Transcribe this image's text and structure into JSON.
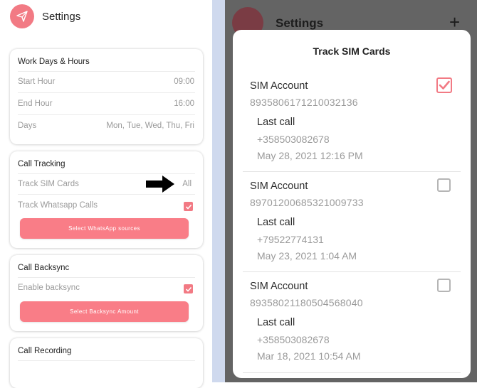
{
  "header": {
    "title": "Settings"
  },
  "work_days": {
    "title": "Work Days & Hours",
    "rows": [
      {
        "label": "Start Hour",
        "value": "09:00"
      },
      {
        "label": "End Hour",
        "value": "16:00"
      },
      {
        "label": "Days",
        "value": "Mon, Tue, Wed, Thu, Fri"
      }
    ]
  },
  "call_tracking": {
    "title": "Call Tracking",
    "track_sim_label": "Track SIM Cards",
    "track_sim_value": "All",
    "track_whatsapp_label": "Track Whatsapp Calls",
    "track_whatsapp_checked": true,
    "whatsapp_button": "Select WhatsApp sources"
  },
  "backsync": {
    "title": "Call Backsync",
    "enable_label": "Enable backsync",
    "enable_checked": true,
    "amount_button": "Select Backsync Amount"
  },
  "recording": {
    "title": "Call Recording"
  },
  "background": {
    "title": "Settings",
    "plus": "+"
  },
  "modal": {
    "title": "Track SIM Cards",
    "sims": [
      {
        "name": "SIM Account",
        "number": "8935806171210032136",
        "last_label": "Last call",
        "last_phone": "+358503082678",
        "last_date": "May 28, 2021 12:16 PM",
        "checked": true
      },
      {
        "name": "SIM Account",
        "number": "89701200685321009733",
        "last_label": "Last call",
        "last_phone": "+79522774131",
        "last_date": "May 23, 2021 1:04 AM",
        "checked": false
      },
      {
        "name": "SIM Account",
        "number": "89358021180504568040",
        "last_label": "Last call",
        "last_phone": "+358503082678",
        "last_date": "Mar 18, 2021 10:54 AM",
        "checked": false
      }
    ]
  },
  "colors": {
    "accent": "#f27a84",
    "button": "#f97d87",
    "overlay": "#646464",
    "separator": "#cfd9ee"
  }
}
